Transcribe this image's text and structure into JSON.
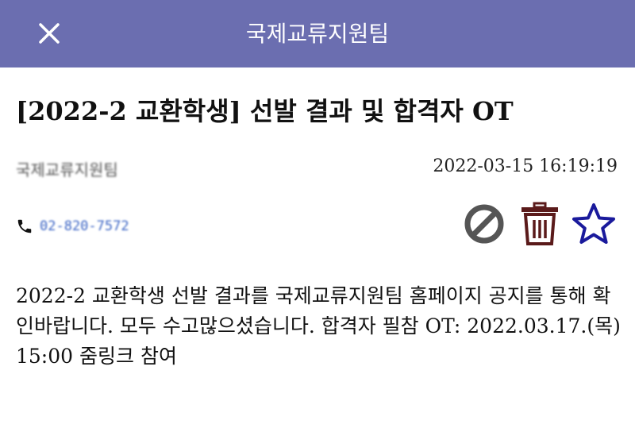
{
  "header": {
    "title": "국제교류지원팀",
    "close_icon": "close-icon",
    "background_color": "#6b6eb0"
  },
  "post": {
    "title": "[2022-2 교환학생] 선발 결과 및 합격자 OT",
    "author": "국제교류지원팀",
    "datetime": "2022-03-15 16:19:19",
    "phone": "02-820-7572",
    "body": "2022-2 교환학생 선발 결과를 국제교류지원팀 홈페이지 공지를 통해 확인바랍니다. 모두 수고많으셨습니다. 합격자 필참 OT: 2022.03.17.(목) 15:00 줌링크 참여"
  },
  "actions": {
    "block_icon": "block-icon",
    "delete_icon": "trash-icon",
    "favorite_icon": "star-icon",
    "colors": {
      "block": "#555555",
      "delete": "#5a1a1a",
      "favorite": "#1a1a9c"
    }
  }
}
